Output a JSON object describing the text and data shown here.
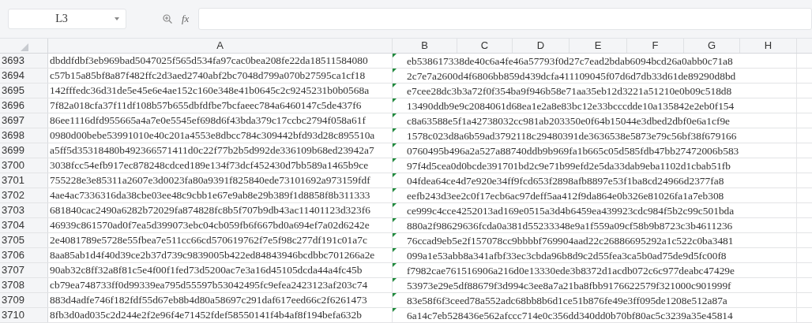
{
  "formula_bar": {
    "cell_reference": "L3",
    "function_label": "fx"
  },
  "columns": [
    "A",
    "B",
    "C",
    "D",
    "E",
    "F",
    "G",
    "H"
  ],
  "rows": [
    {
      "number": "3693",
      "a": "dbddfdbf3eb969bad5047025f565d534fa97cac0bea208fe22da18511584080",
      "b": "eb538617338de40c6a4fe46a57793f0d27c7ead2bdab6094bcd26a0abb0c71a8",
      "flagged": true
    },
    {
      "number": "3694",
      "a": "c57b15a85bf8a87f482ffc2d3aed2740abf2bc7048d799a070b27595ca1cf18",
      "b": "2c7e7a2600d4f6806bb859d439dcfa411109045f07d6d7db33d61de89290d8bd",
      "flagged": true
    },
    {
      "number": "3695",
      "a": "142fffedc36d31de5e45e6e4ae152c160e348e41b0645c2c9245231b0b0568a",
      "b": "e7cee28dc3b3a72f0f354ba9f946b58e71aa35eb12d3221a51210e0b09c518d8",
      "flagged": true
    },
    {
      "number": "3696",
      "a": "7f82a018cfa37f11df108b57b655dbfdfbe7bcfaeec784a6460147c5de437f6",
      "b": "13490ddb9e9c2084061d68ea1e2a8e83bc12e33bcccdde10a135842e2eb0f154",
      "flagged": true
    },
    {
      "number": "3697",
      "a": "86ee1116dfd955665a4a7e0e5545ef698d6f43bda379c17ccbc2794f058a61f",
      "b": "c8a63588e5f1a42738032cc981ab203350e0f64b15044e3dbed2dbf0e6a1cf9e",
      "flagged": true
    },
    {
      "number": "3698",
      "a": "0980d00bebe53991010e40c201a4553e8dbcc784c309442bfd93d28c895510a",
      "b": "1578c023d8a6b59ad3792118c29480391de3636538e5873e79c56bf38f679166",
      "flagged": true
    },
    {
      "number": "3699",
      "a": "a5ff5d35318480b492366571411d0c22f77b2b5d992de336109b68ed23942a7",
      "b": "0760495b496a2a527a88740ddb9b969fa1b665c05d585fdb47bb27472006b583",
      "flagged": true
    },
    {
      "number": "3700",
      "a": "3038fcc54efb917ec878248cdced189e134f73dcf452430d7bb589a1465b9ce",
      "b": "97f4d5cea0d0bcde391701bd2c9e71b99efd2e5da33dab9eba1102d1cbab51fb",
      "flagged": true
    },
    {
      "number": "3701",
      "a": "755228e3e85311a2607e3d0023fa80a9391f825840ede73101692a973159fdf",
      "b": "04fdea64ce4d7e920e34ff9fcd653f2898afb8897e53f1ba8cd24966d2377fa8",
      "flagged": true
    },
    {
      "number": "3702",
      "a": "4ae4ac7336316da38cbe03ee48c9cbb1e67e9ab8e29b389f1d8858f8b311333",
      "b": "eefb243d3ee2c0f17ecb6ac97deff5aa412f9da864e0b326e81026fa1a7eb308",
      "flagged": true
    },
    {
      "number": "3703",
      "a": "681840cac2490a6282b72029fa874828fc8b5f707b9db43ac11401123d323f6",
      "b": "ce999c4cce4252013ad169e0515a3d4b6459ea439923cdc984f5b2c99c501bda",
      "flagged": true
    },
    {
      "number": "3704",
      "a": "46939c861570ad0f7ea5d399073ebc04cb059fb6f667bd0a694ef7a02d6242e",
      "b": "880a2f98629636fcda0a381d55233348e9a1f559a09cf58b9b8723c3b4611236",
      "flagged": true
    },
    {
      "number": "3705",
      "a": "2e4081789e5728e55fbea7e511cc66cd570619762f7e5f98c277df191c01a7c",
      "b": "76ccad9eb5e2f157078cc9bbbbf769904aad22c26886695292a1c522c0ba3481",
      "flagged": true
    },
    {
      "number": "3706",
      "a": "8aa85ab1d4f40d39ce2b37d739c9839005b422ed84843946bcdbbc701266a2e",
      "b": "099a1e53abb8a341afbf33ec3cbda96b8d9c2d55fea3ca5b0ad75de9d5fc00f8",
      "flagged": true
    },
    {
      "number": "3707",
      "a": "90ab32c8ff32a8f81c5e4f00f1fed73d5200ac7e3a16d45105dcda44a4fc45b",
      "b": "f7982cae761516906a216d0e13330ede3b8372d1acdb072c6c977deabc47429e",
      "flagged": true
    },
    {
      "number": "3708",
      "a": "cb79ea748733ff0d99339ea795d55597b53042495fc9efea2423123af203c74",
      "b": "53973e29e5df88679f3d994c3ee8a7a21ba8fbb9176622579f321000c901999f",
      "flagged": true
    },
    {
      "number": "3709",
      "a": "883d4adfe746f182fdf55d67eb8b4d80a58697c291daf617eed66c2f6261473",
      "b": "83e58f6f3ceed78a552adc68bb8b6d1ce51b876fe49e3ff095de1208e512a87a",
      "flagged": true
    },
    {
      "number": "3710",
      "a": "8fb3d0ad035c2d244e2f2e96f4e71452fdef58550141f4b4af8f194befa632b",
      "b": "6a14c7eb528436e562afccc714e0c356dd340dd0b70bf80ac5c3239a35e45814",
      "flagged": true
    }
  ]
}
